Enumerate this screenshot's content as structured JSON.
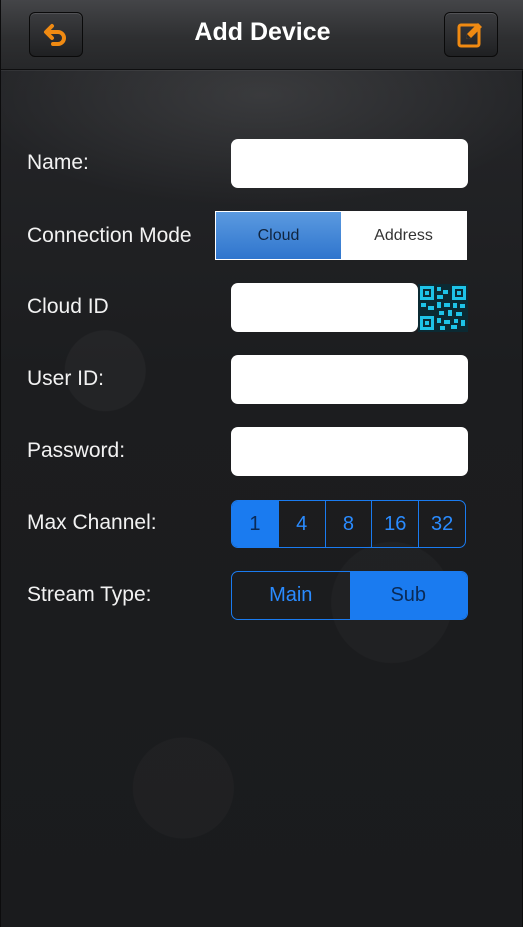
{
  "header": {
    "title": "Add Device",
    "back_icon": "back-arrow-icon",
    "edit_icon": "edit-icon"
  },
  "form": {
    "name": {
      "label": "Name:",
      "value": ""
    },
    "connection_mode": {
      "label": "Connection Mode",
      "options": [
        "Cloud",
        "Address"
      ],
      "selected": "Cloud"
    },
    "cloud_id": {
      "label": "Cloud ID",
      "value": "",
      "scan_icon": "qr-code-icon"
    },
    "user_id": {
      "label": "User ID:",
      "value": ""
    },
    "password": {
      "label": "Password:",
      "value": ""
    },
    "max_channel": {
      "label": "Max Channel:",
      "options": [
        "1",
        "4",
        "8",
        "16",
        "32"
      ],
      "selected": "1"
    },
    "stream_type": {
      "label": "Stream Type:",
      "options": [
        "Main",
        "Sub"
      ],
      "selected": "Sub"
    }
  },
  "colors": {
    "accent_orange": "#f08a12",
    "accent_blue": "#1a7bf0",
    "qr_cyan": "#1ec3e8"
  }
}
